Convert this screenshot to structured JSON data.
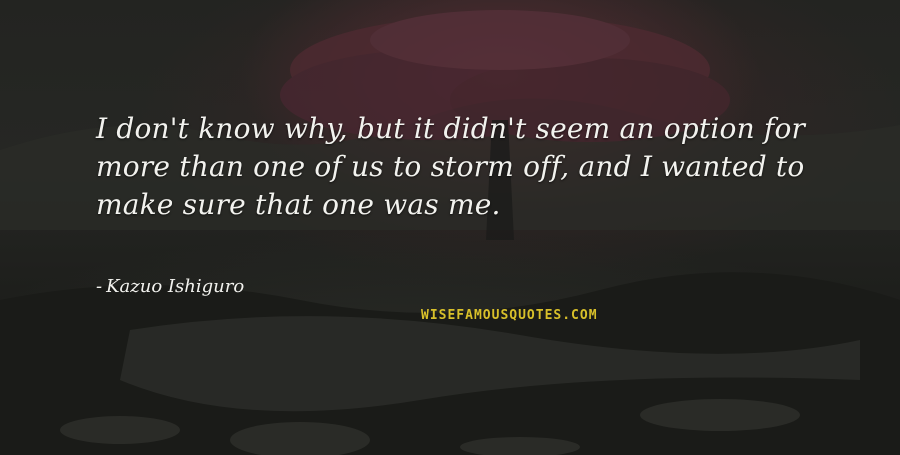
{
  "quote": {
    "line1": "I don't know why, but it didn't seem an option for",
    "line2": "more than one of us to storm off, and I wanted to",
    "line3": "make sure that one was me."
  },
  "author": {
    "dash": "-",
    "name": "Kazuo Ishiguro"
  },
  "watermark": "WISEFAMOUSQUOTES.COM",
  "colors": {
    "text": "#f2f2ee",
    "watermark": "#d8c02a",
    "background": "#1f201d",
    "tree_canopy": "#5c2e36"
  }
}
